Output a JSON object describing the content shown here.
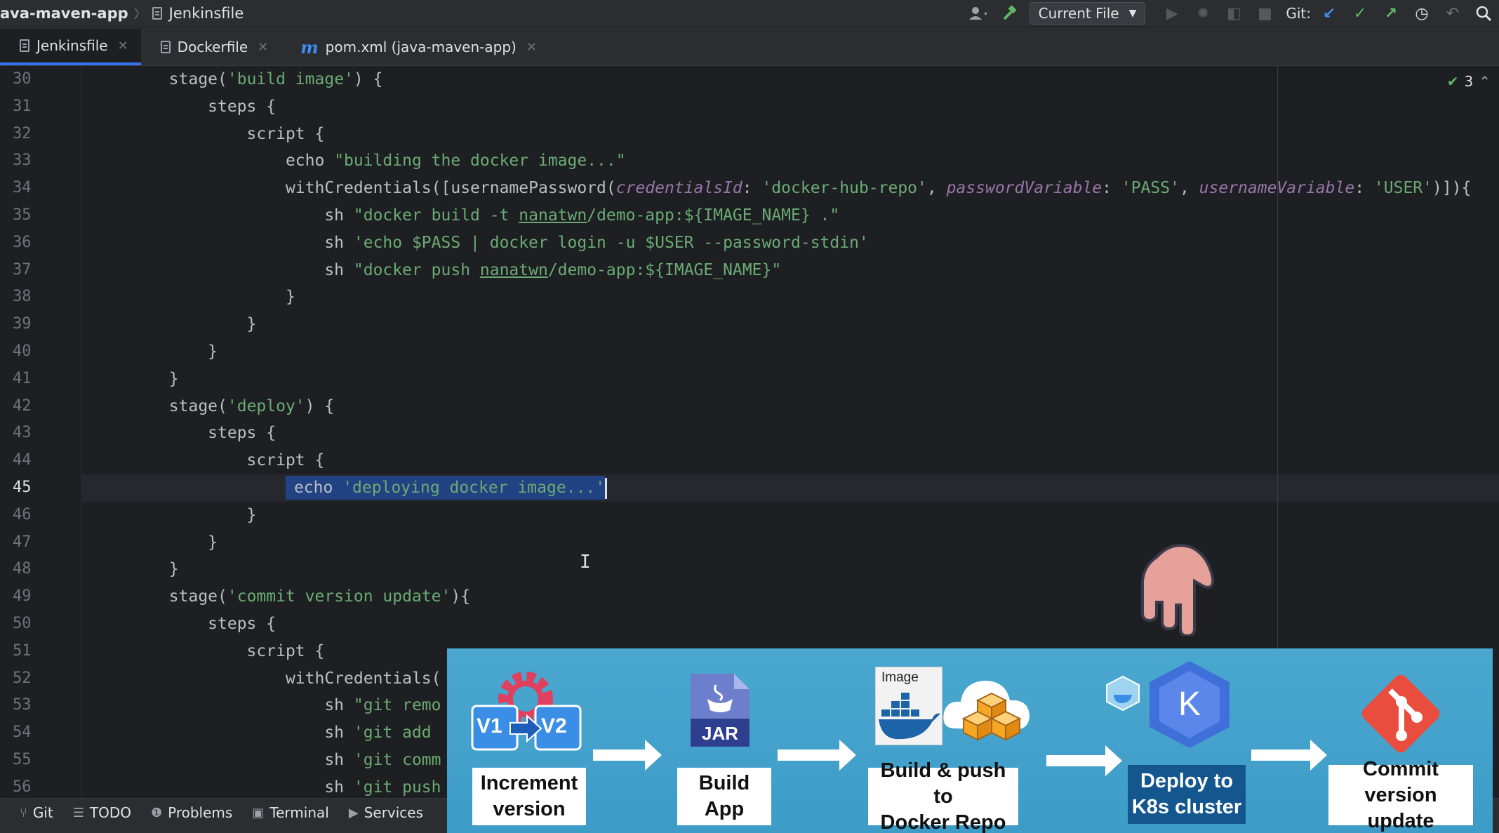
{
  "topbar": {
    "project": "ava-maven-app",
    "file": "Jenkinsfile",
    "run_config": "Current File",
    "git_label": "Git:"
  },
  "tabs": [
    {
      "label": "Jenkinsfile",
      "active": true
    },
    {
      "label": "Dockerfile",
      "active": false
    },
    {
      "label": "pom.xml (java-maven-app)",
      "active": false
    }
  ],
  "editor": {
    "inspection_count": "3",
    "current_line": "45",
    "line_numbers": [
      "30",
      "31",
      "32",
      "33",
      "34",
      "35",
      "36",
      "37",
      "38",
      "39",
      "40",
      "41",
      "42",
      "43",
      "44",
      "45",
      "46",
      "47",
      "48",
      "49",
      "50",
      "51",
      "52",
      "53",
      "54",
      "55",
      "56"
    ],
    "code": {
      "l30a": "        stage(",
      "l30b": "'build image'",
      "l30c": ") {",
      "l31": "            steps {",
      "l32": "                script {",
      "l33a": "                    echo ",
      "l33b": "\"building the docker image...\"",
      "l34a": "                    withCredentials([usernamePassword(",
      "l34b": "credentialsId",
      "l34c": ": ",
      "l34d": "'docker-hub-repo'",
      "l34e": ", ",
      "l34f": "passwordVariable",
      "l34g": ": ",
      "l34h": "'PASS'",
      "l34i": ", ",
      "l34j": "usernameVariable",
      "l34k": ": ",
      "l34l": "'USER'",
      "l34m": ")]){",
      "l35a": "                        sh ",
      "l35b": "\"docker build -t ",
      "l35c": "nanatwn",
      "l35d": "/demo-app:${IMAGE_NAME} .\"",
      "l36a": "                        sh ",
      "l36b": "'echo $PASS | docker login -u $USER --password-stdin'",
      "l37a": "                        sh ",
      "l37b": "\"docker push ",
      "l37c": "nanatwn",
      "l37d": "/demo-app:${IMAGE_NAME}\"",
      "l38": "                    }",
      "l39": "                }",
      "l40": "            }",
      "l41": "        }",
      "l42a": "        stage(",
      "l42b": "'deploy'",
      "l42c": ") {",
      "l43": "            steps {",
      "l44": "                script {",
      "l45a": "                    ",
      "l45b": "echo ",
      "l45c": "'deploying docker image...'",
      "l46": "                }",
      "l47": "            }",
      "l48": "        }",
      "l49a": "        stage(",
      "l49b": "'commit version update'",
      "l49c": "){",
      "l50": "            steps {",
      "l51": "                script {",
      "l52": "                    withCredentials(",
      "l53a": "                        sh ",
      "l53b": "\"git remo",
      "l54a": "                        sh ",
      "l54b": "'git add",
      "l55a": "                        sh ",
      "l55b": "'git comm",
      "l56a": "                        sh ",
      "l56b": "'git push"
    }
  },
  "toolwindows": [
    "Git",
    "TODO",
    "Problems",
    "Terminal",
    "Services"
  ],
  "overlay": {
    "image_tag": "Image",
    "version_old": "V1",
    "version_new": "V2",
    "jar": "JAR",
    "k8s_letter": "K",
    "steps": [
      {
        "line1": "Increment",
        "line2": "version"
      },
      {
        "line1": "Build",
        "line2": "App"
      },
      {
        "line1": "Build & push to",
        "line2": "Docker Repo"
      },
      {
        "line1": "Deploy to",
        "line2": "K8s cluster"
      },
      {
        "line1": "Commit",
        "line2": "version update"
      }
    ]
  },
  "colors": {
    "editor_bg": "#1e1f22",
    "string": "#6aab73",
    "param": "#9876aa",
    "selection": "#214283",
    "accent": "#3574f0",
    "overlay_bg": "#4aa7cf",
    "k8s_label": "#14578e"
  }
}
